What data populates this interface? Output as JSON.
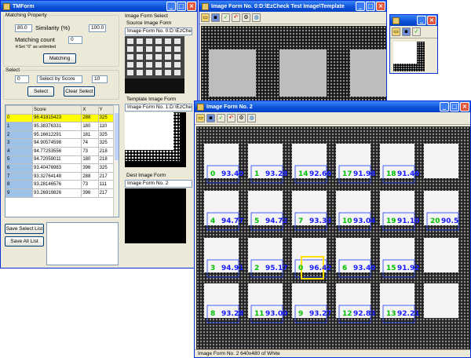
{
  "tmform": {
    "title": "TMForm",
    "matching_property_label": "Matching Property",
    "similarity_min": "80.0",
    "similarity_label": "Similarity (%)",
    "similarity_max": "100.0",
    "matching_count_label": "Matching count",
    "matching_count_value": "0",
    "matching_count_note": "※Set \"0\" as unlimited",
    "matching_button": "Matching",
    "select_label": "Select",
    "select_min": "0",
    "select_by": "Select by Score",
    "select_max": "10",
    "select_button": "Select",
    "clear_select_button": "Clear Select",
    "grid_headers": [
      "",
      "Score",
      "X",
      "Y"
    ],
    "grid_rows": [
      [
        "0",
        "96.41815423",
        "288",
        "325"
      ],
      [
        "1",
        "95.38376331",
        "180",
        "110"
      ],
      [
        "2",
        "95.16612291",
        "181",
        "325"
      ],
      [
        "3",
        "94.90574598",
        "74",
        "325"
      ],
      [
        "4",
        "94.77253556",
        "73",
        "218"
      ],
      [
        "5",
        "94.72059011",
        "180",
        "218"
      ],
      [
        "6",
        "93.40476983",
        "396",
        "325"
      ],
      [
        "7",
        "93.32764148",
        "288",
        "217"
      ],
      [
        "8",
        "93.28146576",
        "73",
        "111"
      ],
      [
        "9",
        "93.26919826",
        "396",
        "217"
      ]
    ],
    "save_select_button": "Save Select List",
    "save_all_button": "Save All List",
    "image_form_select_label": "Image Form Select",
    "source_image_form_label": "Source Image Form",
    "source_image_form_value": "Image Form No. 0:D:\\EzCheck Te",
    "template_image_form_label": "Template Image Form",
    "template_image_form_value": "Image Form No. 1:D:\\EzCheck Te",
    "dest_image_form_label": "Dest Image Form",
    "dest_image_form_value": "Image Form No. 2"
  },
  "form0": {
    "title": "Image Form No. 0:D:\\EzCheck Test Image\\Template"
  },
  "form2": {
    "title": "Image Form No. 2",
    "status": "Image Form No. 2    640x480 of White",
    "match_labels": [
      [
        "0",
        "93.40"
      ],
      [
        "1",
        "93.28"
      ],
      [
        "14",
        "92.66"
      ],
      [
        "17",
        "91.98"
      ],
      [
        "18",
        "91.46"
      ],
      [
        "4",
        "94.77"
      ],
      [
        "5",
        "94.72"
      ],
      [
        "7",
        "93.33"
      ],
      [
        "10",
        "93.04"
      ],
      [
        "19",
        "91.10"
      ],
      [
        "20",
        "90.5"
      ],
      [
        "3",
        "94.91"
      ],
      [
        "2",
        "95.17"
      ],
      [
        "0",
        "96.42"
      ],
      [
        "6",
        "93.40"
      ],
      [
        "15",
        "91.92"
      ],
      [
        "8",
        "93.28"
      ],
      [
        "11",
        "93.00"
      ],
      [
        "9",
        "93.27"
      ],
      [
        "12",
        "92.83"
      ],
      [
        "13",
        "92.21"
      ]
    ]
  },
  "colors": {
    "titlebar": "#0a4fd6",
    "selected_row": "#ffff00",
    "match_box": "#1f3cff",
    "label_green": "#00c000",
    "label_blue": "#1a1aff",
    "highlight": "#ffe000"
  },
  "icons": [
    "folder-icon",
    "save-icon",
    "check-icon",
    "undo-icon",
    "gear-icon",
    "globe-icon",
    "minimize-icon",
    "maximize-icon",
    "close-icon"
  ]
}
